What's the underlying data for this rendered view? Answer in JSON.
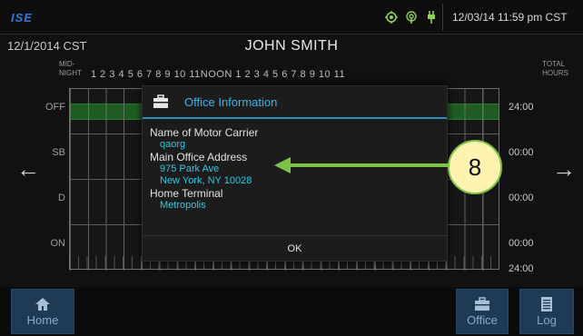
{
  "status_bar": {
    "logo": "ISE",
    "datetime": "12/03/14 11:59 pm CST",
    "icons": [
      "gps-icon",
      "signal-icon",
      "power-plug-icon"
    ],
    "icon_color": "#8fd14f"
  },
  "header": {
    "date": "12/1/2014 CST",
    "driver": "JOHN SMITH"
  },
  "log_grid": {
    "left_axis_label": "MID-\nNIGHT",
    "hour_labels": "1  2  3  4  5  6  7  8  9  10  11NOON 1  2  3  4  5  6  7  8  9  10  11",
    "right_axis_label": "TOTAL\nHOURS",
    "rows": [
      {
        "label": "OFF",
        "total": "24:00"
      },
      {
        "label": "SB",
        "total": "00:00"
      },
      {
        "label": "D",
        "total": "00:00"
      },
      {
        "label": "ON",
        "total": "00:00"
      }
    ],
    "grand_total": "24:00",
    "off_color": "#1f5c23"
  },
  "nav": {
    "prev": "←",
    "next": "→"
  },
  "footer": {
    "home_label": "Home",
    "office_label": "Office",
    "log_label": "Log",
    "button_color": "#1e3a55"
  },
  "dialog": {
    "title": "Office Information",
    "carrier_label": "Name of Motor Carrier",
    "carrier_value": "qaorg",
    "address_label": "Main Office Address",
    "address_line1": "975 Park Ave",
    "address_line2": "New York, NY 10028",
    "terminal_label": "Home Terminal",
    "terminal_value": "Metropolis",
    "ok_label": "OK",
    "accent_color": "#2b8fbd"
  },
  "annotation": {
    "number": "8",
    "arrow_color": "#7cc448"
  }
}
